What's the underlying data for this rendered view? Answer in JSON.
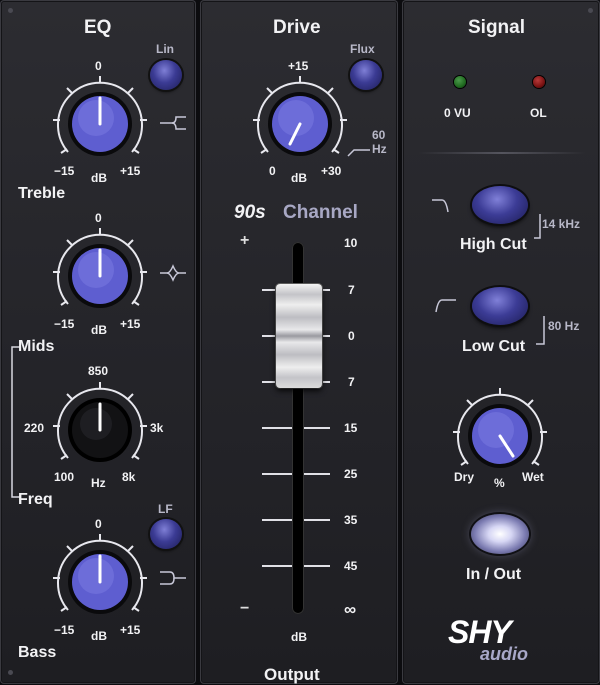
{
  "eq": {
    "title": "EQ",
    "lin_label": "Lin",
    "lf_label": "LF",
    "treble": {
      "label": "Treble",
      "scale_top": "0",
      "scale_min": "−15",
      "scale_max": "+15",
      "unit": "dB"
    },
    "mids": {
      "scale_top": "0",
      "scale_min": "−15",
      "scale_max": "+15",
      "unit": "dB",
      "label": "Mids"
    },
    "freq": {
      "label": "Freq",
      "scale_top": "850",
      "scale_left": "220",
      "scale_right": "3k",
      "scale_min": "100",
      "scale_max": "8k",
      "unit": "Hz"
    },
    "bass": {
      "label": "Bass",
      "scale_top": "0",
      "scale_min": "−15",
      "scale_max": "+15",
      "unit": "dB"
    }
  },
  "drive": {
    "title": "Drive",
    "flux_label": "Flux",
    "scale_top": "+15",
    "scale_min": "0",
    "scale_max": "+30",
    "unit": "dB",
    "hz_value": "60",
    "hz_unit": "Hz",
    "channel_brand": "90s",
    "channel_word": "Channel"
  },
  "output": {
    "label": "Output",
    "unit": "dB",
    "plus": "+",
    "minus": "−",
    "scale": [
      "10",
      "7",
      "0",
      "7",
      "15",
      "25",
      "35",
      "45",
      "∞"
    ]
  },
  "signal": {
    "title": "Signal",
    "led_vu_label": "0 VU",
    "led_ol_label": "OL",
    "high_cut_label": "High Cut",
    "high_cut_freq": "14 kHz",
    "low_cut_label": "Low Cut",
    "low_cut_freq": "80 Hz",
    "mix": {
      "min": "Dry",
      "max": "Wet",
      "unit": "%"
    },
    "inout_label": "In / Out"
  },
  "brand": {
    "name": "SHY",
    "sub": "audio"
  },
  "colors": {
    "accent": "#5e5ed0",
    "led_green": "#1f6a1f",
    "led_red": "#7a1212"
  }
}
